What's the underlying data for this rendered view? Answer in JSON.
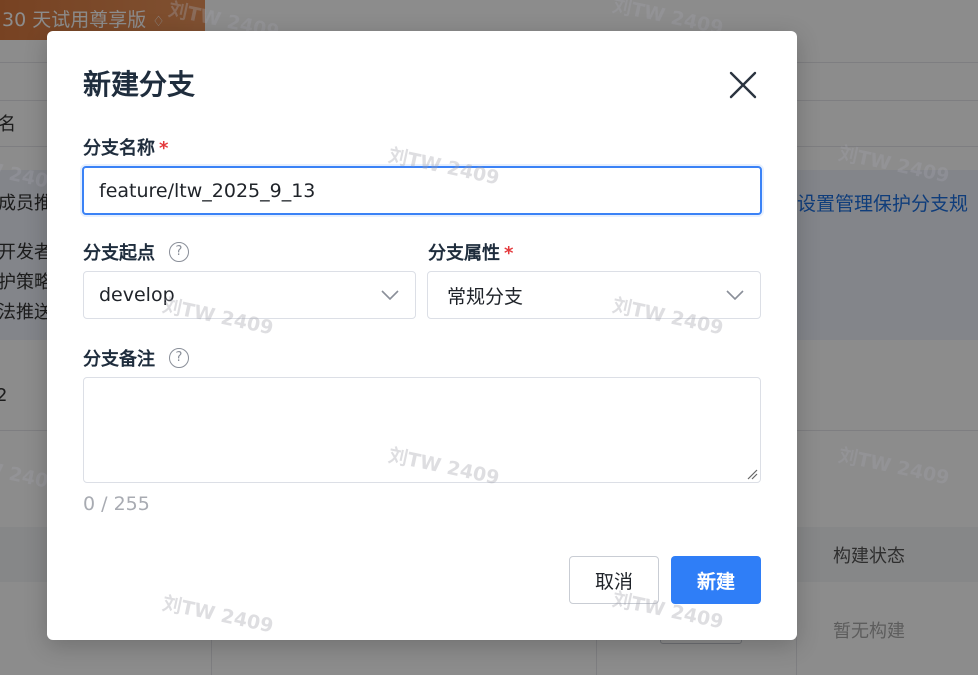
{
  "background": {
    "trial_badge": "30 天试用尊享版",
    "left_fragments": [
      "名",
      "成员推",
      "开发者",
      "护策略",
      "法推送",
      "2"
    ],
    "info_link": "设置管理保护分支规",
    "table_header_last": "构建状态",
    "table_cell_last": "暂无构建"
  },
  "watermark_text": "刘TW 2409",
  "dialog": {
    "title": "新建分支",
    "branch_name": {
      "label": "分支名称",
      "required_mark": "*",
      "value": "feature/ltw_2025_9_13"
    },
    "branch_origin": {
      "label": "分支起点",
      "selected": "develop"
    },
    "branch_attr": {
      "label": "分支属性",
      "required_mark": "*",
      "selected": "常规分支"
    },
    "branch_note": {
      "label": "分支备注",
      "value": "",
      "counter": "0 / 255"
    },
    "cancel_label": "取消",
    "create_label": "新建"
  },
  "icons": {
    "help": "?",
    "close": "close-icon",
    "chevron": "chevron-down-icon",
    "gem": "♢"
  },
  "colors": {
    "primary": "#2f7ef7",
    "focus_border": "#3b82f6",
    "required": "#e4393c"
  }
}
